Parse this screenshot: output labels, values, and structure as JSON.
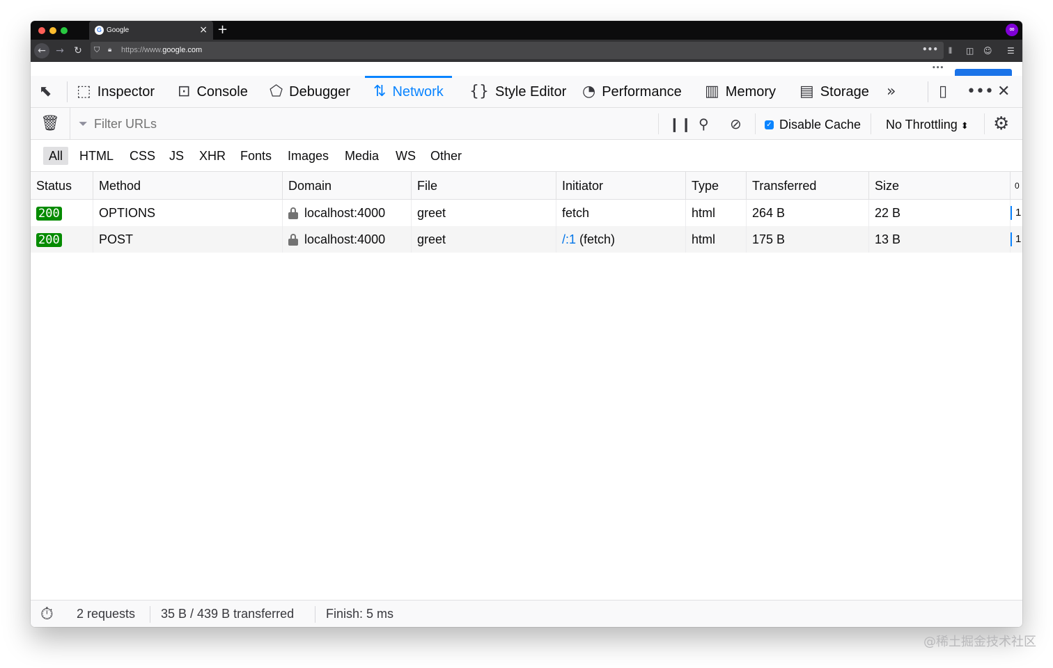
{
  "browser": {
    "tab_title": "Google",
    "favicon_letter": "G",
    "url_prefix": "https://www.",
    "url_host": "google.com"
  },
  "devtools": {
    "tabs": [
      {
        "label": "Inspector",
        "icon": "inspector-icon"
      },
      {
        "label": "Console",
        "icon": "console-icon"
      },
      {
        "label": "Debugger",
        "icon": "debugger-icon"
      },
      {
        "label": "Network",
        "icon": "network-icon",
        "selected": true
      },
      {
        "label": "Style Editor",
        "icon": "style-editor-icon"
      },
      {
        "label": "Performance",
        "icon": "performance-icon"
      },
      {
        "label": "Memory",
        "icon": "memory-icon"
      },
      {
        "label": "Storage",
        "icon": "storage-icon"
      }
    ],
    "accent_color": "#0a84ff"
  },
  "network_toolbar": {
    "filter_placeholder": "Filter URLs",
    "disable_cache_label": "Disable Cache",
    "disable_cache_checked": true,
    "throttling_label": "No Throttling"
  },
  "type_filters": [
    "All",
    "HTML",
    "CSS",
    "JS",
    "XHR",
    "Fonts",
    "Images",
    "Media",
    "WS",
    "Other"
  ],
  "table": {
    "headers": [
      "Status",
      "Method",
      "Domain",
      "File",
      "Initiator",
      "Type",
      "Transferred",
      "Size",
      "0"
    ],
    "rows": [
      {
        "status": "200",
        "method": "OPTIONS",
        "domain": "localhost:4000",
        "file": "greet",
        "initiator": "fetch",
        "initiator_link": "",
        "type": "html",
        "transferred": "264 B",
        "size": "22 B",
        "waterfall": "1"
      },
      {
        "status": "200",
        "method": "POST",
        "domain": "localhost:4000",
        "file": "greet",
        "initiator": "(fetch)",
        "initiator_link": "/:1",
        "type": "html",
        "transferred": "175 B",
        "size": "13 B",
        "waterfall": "1"
      }
    ],
    "status_color": "#058b00"
  },
  "statusbar": {
    "requests": "2 requests",
    "transferred": "35 B / 439 B transferred",
    "finish": "Finish: 5 ms"
  },
  "watermark": "@稀土掘金技术社区"
}
